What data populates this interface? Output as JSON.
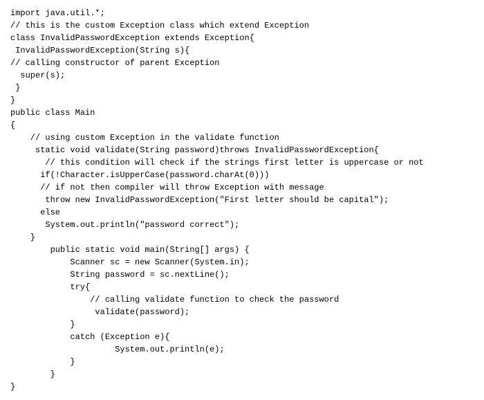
{
  "code": {
    "lines": [
      "import java.util.*;",
      "// this is the custom Exception class which extend Exception",
      "class InvalidPasswordException extends Exception{",
      "",
      " InvalidPasswordException(String s){",
      "",
      "// calling constructor of parent Exception",
      "  super(s);",
      " }",
      "}",
      "",
      "public class Main",
      "{",
      "    // using custom Exception in the validate function",
      "     static void validate(String password)throws InvalidPasswordException{",
      "",
      "       // this condition will check if the strings first letter is uppercase or not",
      "      if(!Character.isUpperCase(password.charAt(0)))",
      "      // if not then compiler will throw Exception with message",
      "       throw new InvalidPasswordException(\"First letter should be capital\");",
      "      else",
      "       System.out.println(\"password correct\");",
      "    }",
      "        public static void main(String[] args) {",
      "",
      "            Scanner sc = new Scanner(System.in);",
      "",
      "            String password = sc.nextLine();",
      "",
      "            try{",
      "                // calling validate function to check the password",
      "                 validate(password);",
      "            }",
      "            catch (Exception e){",
      "                     System.out.println(e);",
      "",
      "            }",
      "        }",
      "}"
    ]
  }
}
